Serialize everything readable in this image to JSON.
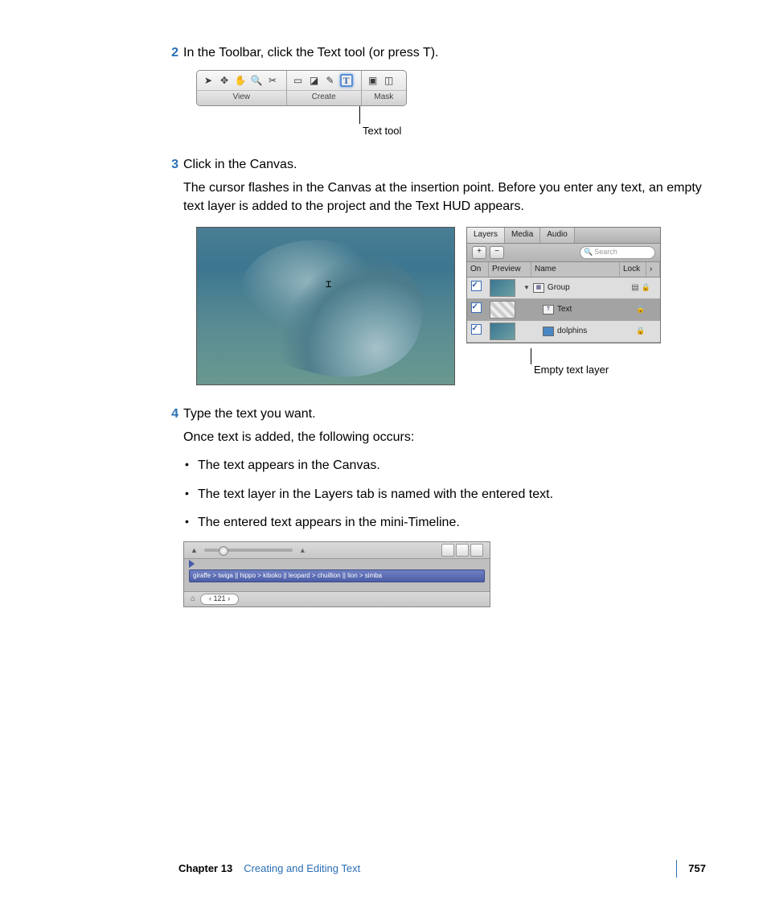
{
  "steps": {
    "s2": {
      "num": "2",
      "text": "In the Toolbar, click the Text tool (or press T)."
    },
    "s3": {
      "num": "3",
      "text": "Click in the Canvas.",
      "para": "The cursor flashes in the Canvas at the insertion point. Before you enter any text, an empty text layer is added to the project and the Text HUD appears."
    },
    "s4": {
      "num": "4",
      "text": "Type the text you want.",
      "para": "Once text is added, the following occurs:"
    }
  },
  "bullets": {
    "b1": "The text appears in the Canvas.",
    "b2": "The text layer in the Layers tab is named with the entered text.",
    "b3": "The entered text appears in the mini-Timeline."
  },
  "toolbar": {
    "groups": {
      "view": "View",
      "create": "Create",
      "mask": "Mask"
    },
    "text_glyph": "T",
    "callout": "Text tool"
  },
  "layers": {
    "tabs": {
      "layers": "Layers",
      "media": "Media",
      "audio": "Audio"
    },
    "search_placeholder": "Search",
    "headers": {
      "on": "On",
      "preview": "Preview",
      "name": "Name",
      "lock": "Lock"
    },
    "rows": {
      "group": "Group",
      "text": "Text",
      "dolphins": "dolphins"
    },
    "callout": "Empty text layer"
  },
  "timeline": {
    "bar_text": "giraffe > twiga || hippo > kiboko || leopard > chuillion || lion > simba",
    "frame": "121"
  },
  "footer": {
    "chapter": "Chapter 13",
    "title": "Creating and Editing Text",
    "page": "757"
  }
}
